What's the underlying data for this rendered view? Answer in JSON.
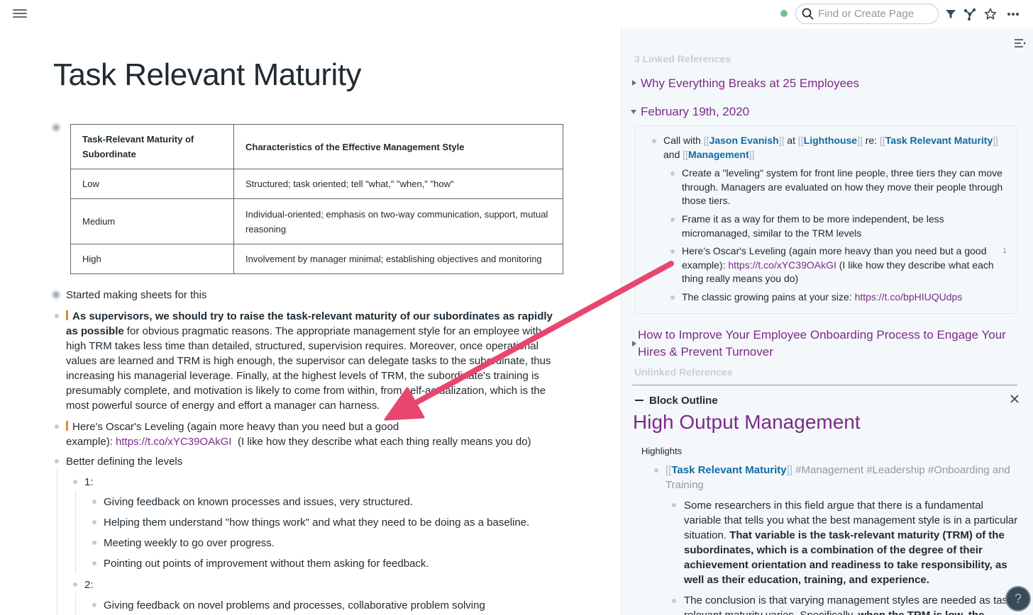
{
  "topbar": {
    "search_placeholder": "Find or Create Page",
    "icons": [
      "menu-icon",
      "search-icon",
      "filter-icon",
      "graph-icon",
      "star-icon",
      "more-icon"
    ],
    "sync_color": "#6cc28b"
  },
  "page": {
    "title": "Task Relevant Maturity",
    "table": {
      "headers": [
        "Task-Relevant Maturity of Subordinate",
        "Characteristics of the Effective Management Style"
      ],
      "rows": [
        {
          "level": "Low",
          "style": "Structured; task oriented; tell \"what,\" \"when,\" \"how\""
        },
        {
          "level": "Medium",
          "style": "Individual-oriented; emphasis on two-way communication, support, mutual reasoning"
        },
        {
          "level": "High",
          "style": "Involvement by manager minimal; establishing objectives and monitoring"
        }
      ]
    },
    "sheets_line": "Started making sheets for this",
    "quote1": {
      "bold": "As supervisors, we should try to raise the task-relevant maturity of our subordinates as rapidly as possible",
      "rest": " for obvious pragmatic reasons. The appropriate management style for an employee with high TRM takes less time than detailed, structured, supervision requires. Moreover, once operational values are learned and TRM is high enough, the supervisor can delegate tasks to the subordinate, thus increasing his managerial leverage. Finally, at the highest levels of TRM, the subordinate's training is presumably complete, and motivation is likely to come from within, from self-actualization, which is the most powerful source of energy and effort a manager can harness."
    },
    "quote2": {
      "before": "Here's Oscar's Leveling (again more heavy than you need but a good example): ",
      "link": "https://t.co/xYC39OAkGI",
      "after": " (I like how they describe what each thing really means you do)"
    },
    "levels_heading": "Better defining the levels",
    "level1_label": "1:",
    "level1_items": [
      "Giving feedback on known processes and issues, very structured.",
      "Helping them understand \"how things work\" and what they need to be doing as a baseline.",
      "Meeting weekly to go over progress.",
      "Pointing out points of improvement without them asking for feedback."
    ],
    "level2_label": "2:",
    "level2_items": [
      "Giving feedback on novel problems and processes, collaborative problem solving"
    ]
  },
  "sidebar": {
    "linked_refs_label": "3 Linked References",
    "ref1_title": "Why Everything Breaks at 25 Employees",
    "ref2_title": "February 19th, 2020",
    "call": {
      "prefix": "Call with ",
      "person": "Jason Evanish",
      "at": " at ",
      "company": "Lighthouse",
      "re": " re: ",
      "topic": "Task Relevant Maturity",
      "and": " and ",
      "topic2": "Management",
      "open": "[[",
      "close": "]]"
    },
    "call_items": [
      "Create a \"leveling\" system for front line people, three tiers they can move through. Managers are evaluated on how they move their people through those tiers.",
      "Frame it as a way for them to be more independent, be less micromanaged, similar to the TRM levels"
    ],
    "oscar": {
      "before": "Here's Oscar's Leveling (again more heavy than you need but a good example): ",
      "link": "https://t.co/xYC39OAkGI",
      "after": " (I like how they describe what each thing really means you do)",
      "count": "1"
    },
    "pains": {
      "before": "The classic growing pains at your size: ",
      "link": "https://t.co/bpHIUQUdps"
    },
    "ref3_title": "How to Improve Your Employee Onboarding Process to Engage Your Hires & Prevent Turnover",
    "unlinked_label": "Unlinked References",
    "outline": {
      "header": "Block Outline",
      "title": "High Output Management",
      "highlights": "Highlights",
      "tags_open": "[[",
      "tags_ref": "Task Relevant Maturity",
      "tags_close": "]]",
      "tags": " #Management #Leadership #Onboarding and Training",
      "para1_plain": "Some researchers in this field argue that there is a fundamental variable that tells you what the best management style is in a particular situation. ",
      "para1_bold": "That variable is the task-relevant maturity (TRM) of the subordinates, which is a combination of the degree of their achievement orientation and readiness to take responsibility, as well as their education, training, and experience.",
      "para2_plain": "The conclusion is that varying management styles are needed as task-relevant maturity varies. Specifically, ",
      "para2_bold": "when the TRM is low, the"
    },
    "help": "?"
  },
  "colors": {
    "link_purple": "#7c2a8a",
    "ref_blue": "#106ba3",
    "arrow": "#e8466f",
    "quote_bar": "#e38b2e"
  }
}
